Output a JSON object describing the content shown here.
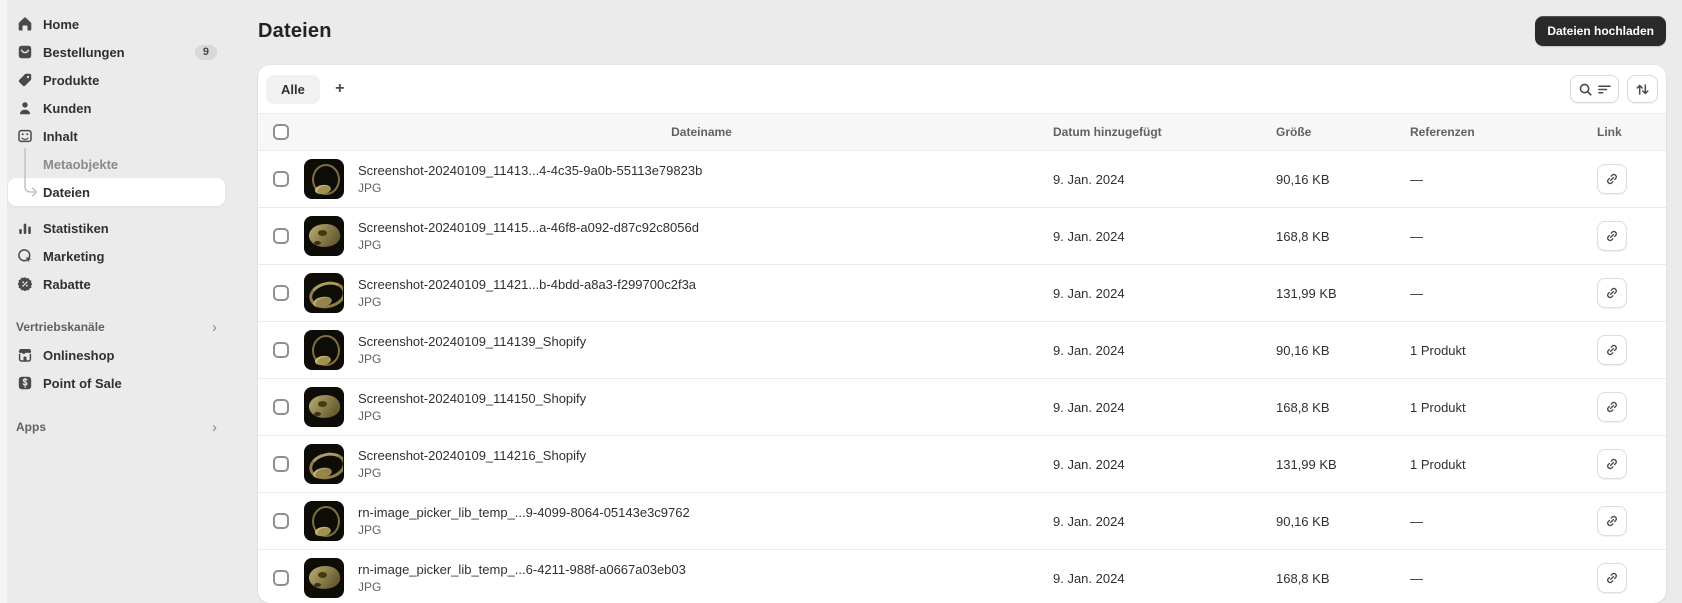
{
  "colors": {
    "background": "#ebebeb",
    "card": "#ffffff",
    "dark_button": "#2a2a2a",
    "selected_item_bg": "#ffffff",
    "thumb_background": "#0d0c07",
    "thumb_gold": "#9c8c52"
  },
  "icons": {
    "chevron_right": "›"
  },
  "sidebar": {
    "items": [
      {
        "label": "Home",
        "icon": "home-icon"
      },
      {
        "label": "Bestellungen",
        "icon": "orders-icon",
        "badge": "9"
      },
      {
        "label": "Produkte",
        "icon": "products-icon"
      },
      {
        "label": "Kunden",
        "icon": "customers-icon"
      },
      {
        "label": "Inhalt",
        "icon": "content-icon"
      }
    ],
    "content_children": [
      {
        "label": "Metaobjekte",
        "selected": false
      },
      {
        "label": "Dateien",
        "selected": true
      }
    ],
    "items_lower": [
      {
        "label": "Statistiken",
        "icon": "stats-icon"
      },
      {
        "label": "Marketing",
        "icon": "marketing-icon"
      },
      {
        "label": "Rabatte",
        "icon": "discount-icon"
      }
    ],
    "sales_channels_section": {
      "label": "Vertriebskanäle",
      "items": [
        {
          "label": "Onlineshop",
          "icon": "store-icon"
        },
        {
          "label": "Point of Sale",
          "icon": "pos-icon"
        }
      ]
    },
    "apps_section": {
      "label": "Apps"
    }
  },
  "header": {
    "title": "Dateien",
    "upload_button_label": "Dateien hochladen"
  },
  "filter_bar": {
    "all_tab_label": "Alle",
    "add_tab_label": "+"
  },
  "table": {
    "columns": [
      "Dateiname",
      "Datum hinzugefügt",
      "Größe",
      "Referenzen",
      "Link"
    ],
    "rows": [
      {
        "name": "Screenshot-20240109_11413...4-4c35-9a0b-55113e79823b",
        "type": "JPG",
        "date": "9. Jan. 2024",
        "size": "90,16 KB",
        "references": "—",
        "thumb": "ring-front"
      },
      {
        "name": "Screenshot-20240109_11415...a-46f8-a092-d87c92c8056d",
        "type": "JPG",
        "date": "9. Jan. 2024",
        "size": "168,8 KB",
        "references": "—",
        "thumb": "ring-side"
      },
      {
        "name": "Screenshot-20240109_11421...b-4bdd-a8a3-f299700c2f3a",
        "type": "JPG",
        "date": "9. Jan. 2024",
        "size": "131,99 KB",
        "references": "—",
        "thumb": "ring-angle"
      },
      {
        "name": "Screenshot-20240109_114139_Shopify",
        "type": "JPG",
        "date": "9. Jan. 2024",
        "size": "90,16 KB",
        "references": "1 Produkt",
        "thumb": "ring-front"
      },
      {
        "name": "Screenshot-20240109_114150_Shopify",
        "type": "JPG",
        "date": "9. Jan. 2024",
        "size": "168,8 KB",
        "references": "1 Produkt",
        "thumb": "ring-side"
      },
      {
        "name": "Screenshot-20240109_114216_Shopify",
        "type": "JPG",
        "date": "9. Jan. 2024",
        "size": "131,99 KB",
        "references": "1 Produkt",
        "thumb": "ring-angle"
      },
      {
        "name": "rn-image_picker_lib_temp_...9-4099-8064-05143e3c9762",
        "type": "JPG",
        "date": "9. Jan. 2024",
        "size": "90,16 KB",
        "references": "—",
        "thumb": "ring-front"
      },
      {
        "name": "rn-image_picker_lib_temp_...6-4211-988f-a0667a03eb03",
        "type": "JPG",
        "date": "9. Jan. 2024",
        "size": "168,8 KB",
        "references": "—",
        "thumb": "ring-side"
      }
    ]
  }
}
